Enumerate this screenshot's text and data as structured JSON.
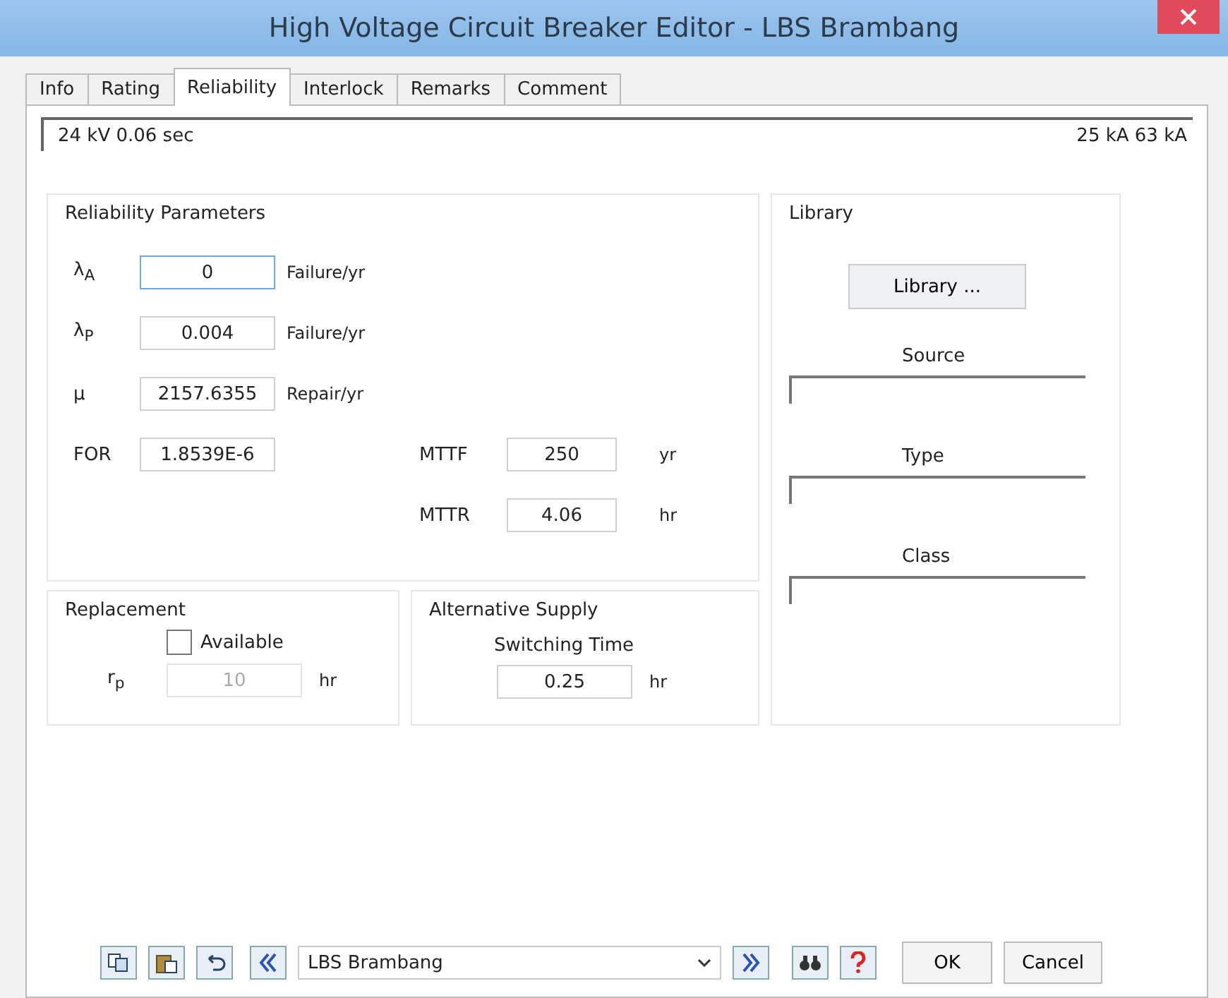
{
  "window": {
    "title": "High Voltage Circuit Breaker Editor - LBS Brambang"
  },
  "tabs": [
    {
      "label": "Info",
      "selected": false
    },
    {
      "label": "Rating",
      "selected": false
    },
    {
      "label": "Reliability",
      "selected": true
    },
    {
      "label": "Interlock",
      "selected": false
    },
    {
      "label": "Remarks",
      "selected": false
    },
    {
      "label": "Comment",
      "selected": false
    }
  ],
  "info_bar": {
    "left": "24 kV  0.06 sec",
    "right": "25 kA  63 kA"
  },
  "reliability_parameters": {
    "title": "Reliability Parameters",
    "rates": [
      {
        "label": "λ$_{A}$",
        "value": "0",
        "unit": "Failure/yr",
        "focused": true
      },
      {
        "label": "λ$_{P}$",
        "value": "0.004",
        "unit": "Failure/yr",
        "focused": false
      },
      {
        "label": "μ",
        "value": "2157.6355",
        "unit": "Repair/yr",
        "focused": false
      }
    ],
    "for": {
      "label": "FOR",
      "value": "1.8539E-6"
    },
    "mttf": {
      "label": "MTTF",
      "value": "250",
      "unit": "yr"
    },
    "mttr": {
      "label": "MTTR",
      "value": "4.06",
      "unit": "hr"
    }
  },
  "replacement": {
    "title": "Replacement",
    "available": {
      "label": "Available",
      "checked": false
    },
    "rp": {
      "label": "r$_{p}$",
      "value": "10",
      "unit": "hr",
      "disabled": true
    }
  },
  "alternative_supply": {
    "title": "Alternative Supply",
    "label": "Switching Time",
    "value": "0.25",
    "unit": "hr"
  },
  "library": {
    "title": "Library",
    "button": "Library ...",
    "fields": [
      {
        "label": "Source"
      },
      {
        "label": "Type"
      },
      {
        "label": "Class"
      }
    ]
  },
  "toolbar": {
    "record": "LBS Brambang",
    "ok": "OK",
    "cancel": "Cancel"
  }
}
